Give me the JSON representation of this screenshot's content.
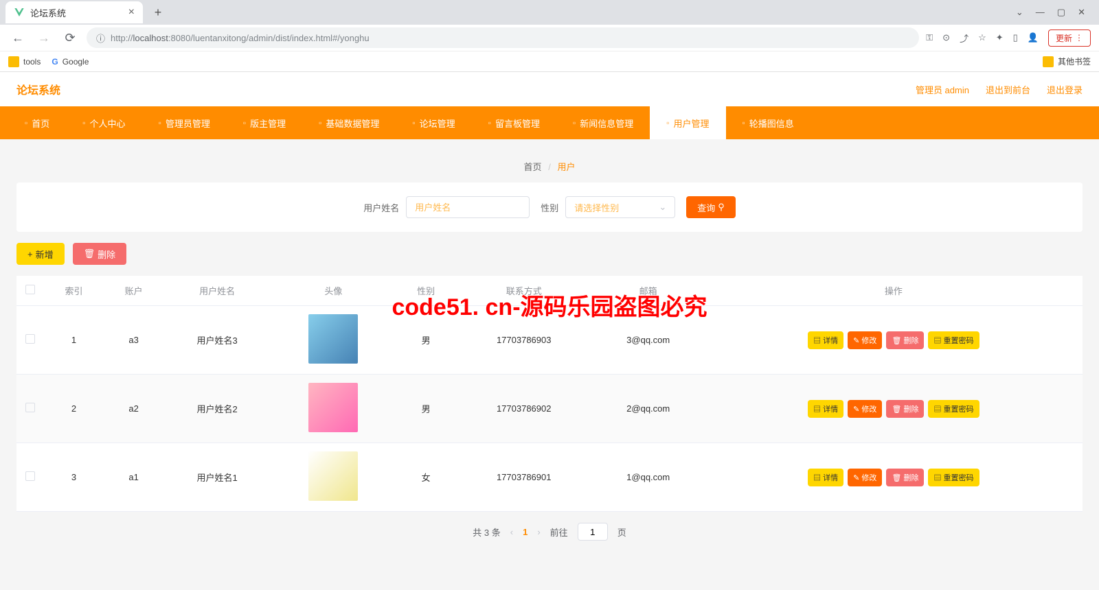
{
  "browser": {
    "tab_title": "论坛系统",
    "url_protocol": "http://",
    "url_host": "localhost",
    "url_path": ":8080/luentanxitong/admin/dist/index.html#/yonghu",
    "update_label": "更新",
    "bookmarks": {
      "tools": "tools",
      "google": "Google",
      "other": "其他书签"
    }
  },
  "app": {
    "title": "论坛系统",
    "header_links": {
      "admin": "管理员 admin",
      "to_front": "退出到前台",
      "logout": "退出登录"
    },
    "nav": [
      "首页",
      "个人中心",
      "管理员管理",
      "版主管理",
      "基础数据管理",
      "论坛管理",
      "留言板管理",
      "新闻信息管理",
      "用户管理",
      "轮播图信息"
    ],
    "nav_active_index": 8,
    "breadcrumb": {
      "home": "首页",
      "current": "用户"
    },
    "search": {
      "name_label": "用户姓名",
      "name_placeholder": "用户姓名",
      "gender_label": "性别",
      "gender_placeholder": "请选择性别",
      "query_btn": "查询"
    },
    "actions": {
      "add": "新增",
      "delete": "删除"
    },
    "table": {
      "headers": [
        "索引",
        "账户",
        "用户姓名",
        "头像",
        "性别",
        "联系方式",
        "邮箱",
        "操作"
      ],
      "rows": [
        {
          "index": "1",
          "account": "a3",
          "name": "用户姓名3",
          "gender": "男",
          "phone": "17703786903",
          "email": "3@qq.com"
        },
        {
          "index": "2",
          "account": "a2",
          "name": "用户姓名2",
          "gender": "男",
          "phone": "17703786902",
          "email": "2@qq.com"
        },
        {
          "index": "3",
          "account": "a1",
          "name": "用户姓名1",
          "gender": "女",
          "phone": "17703786901",
          "email": "1@qq.com"
        }
      ],
      "ops": {
        "detail": "详情",
        "edit": "修改",
        "delete": "删除",
        "reset_pwd": "重置密码"
      }
    },
    "pagination": {
      "total": "共 3 条",
      "current": "1",
      "goto": "前往",
      "page_suffix": "页",
      "goto_value": "1"
    }
  },
  "watermark": "code51. cn-源码乐园盗图必究"
}
